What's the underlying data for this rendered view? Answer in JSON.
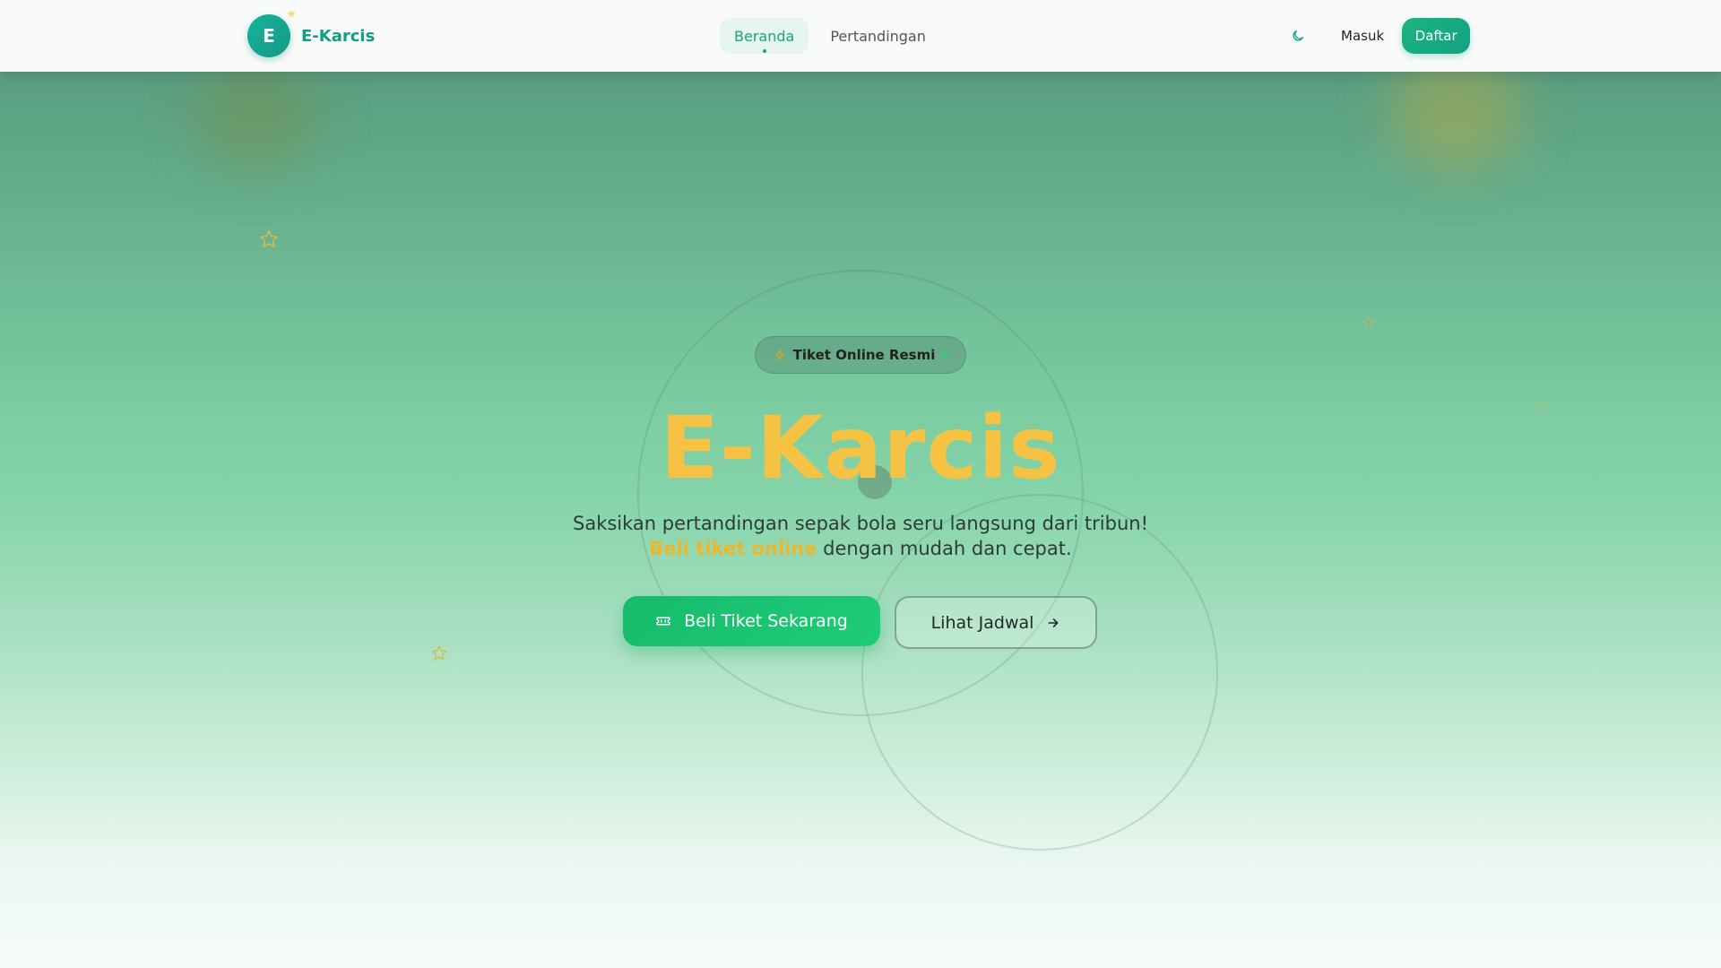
{
  "navbar": {
    "logo_letter": "E",
    "brand_name": "E-Karcis",
    "links": [
      {
        "label": "Beranda",
        "active": true
      },
      {
        "label": "Pertandingan",
        "active": false
      }
    ],
    "login_label": "Masuk",
    "register_label": "Daftar",
    "theme_icon": "moon-icon"
  },
  "hero": {
    "badge_label": "Tiket Online Resmi",
    "title": "E-Karcis",
    "subtitle_line1": "Saksikan pertandingan sepak bola seru langsung dari tribun!",
    "subtitle_highlight": "Beli tiket online",
    "subtitle_rest": " dengan mudah dan cepat.",
    "primary_button": "Beli Tiket Sekarang",
    "secondary_button": "Lihat Jadwal"
  },
  "colors": {
    "brand": "#129e84",
    "accent_yellow": "#f6c244",
    "primary_green": "#16bb6c"
  },
  "icons": [
    "sparkle-icon",
    "moon-icon",
    "bolt-icon",
    "ticket-icon",
    "arrow-right-icon",
    "star-icon"
  ]
}
